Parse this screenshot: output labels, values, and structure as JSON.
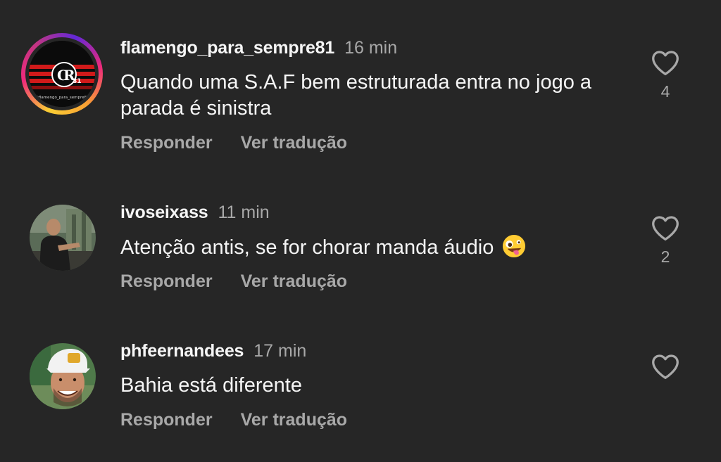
{
  "colors": {
    "background": "#262626",
    "primary_text": "#f5f5f5",
    "secondary_text": "#a8a8a8",
    "story_ring": [
      "#f9ce34",
      "#ee2a7b",
      "#6228d7"
    ]
  },
  "comments": [
    {
      "username": "flamengo_para_sempre81",
      "time": "16 min",
      "text": "Quando uma S.A.F bem estruturada entra no jogo a parada é sinistra",
      "reply_label": "Responder",
      "translate_label": "Ver tradução",
      "like_icon": "heart-outline-icon",
      "likes": "4",
      "avatar": {
        "badge": "CR81",
        "caption": "@flamengo_para_sempre81",
        "has_story_ring": true
      }
    },
    {
      "username": "ivoseixass",
      "time": "11 min",
      "text": "Atenção antis, se for chorar manda áudio",
      "emoji": "zany-face-emoji",
      "reply_label": "Responder",
      "translate_label": "Ver tradução",
      "like_icon": "heart-outline-icon",
      "likes": "2",
      "avatar": {
        "has_story_ring": false
      }
    },
    {
      "username": "phfeernandees",
      "time": "17 min",
      "text": "Bahia está diferente",
      "reply_label": "Responder",
      "translate_label": "Ver tradução",
      "like_icon": "heart-outline-icon",
      "likes": "",
      "avatar": {
        "has_story_ring": false
      }
    }
  ]
}
